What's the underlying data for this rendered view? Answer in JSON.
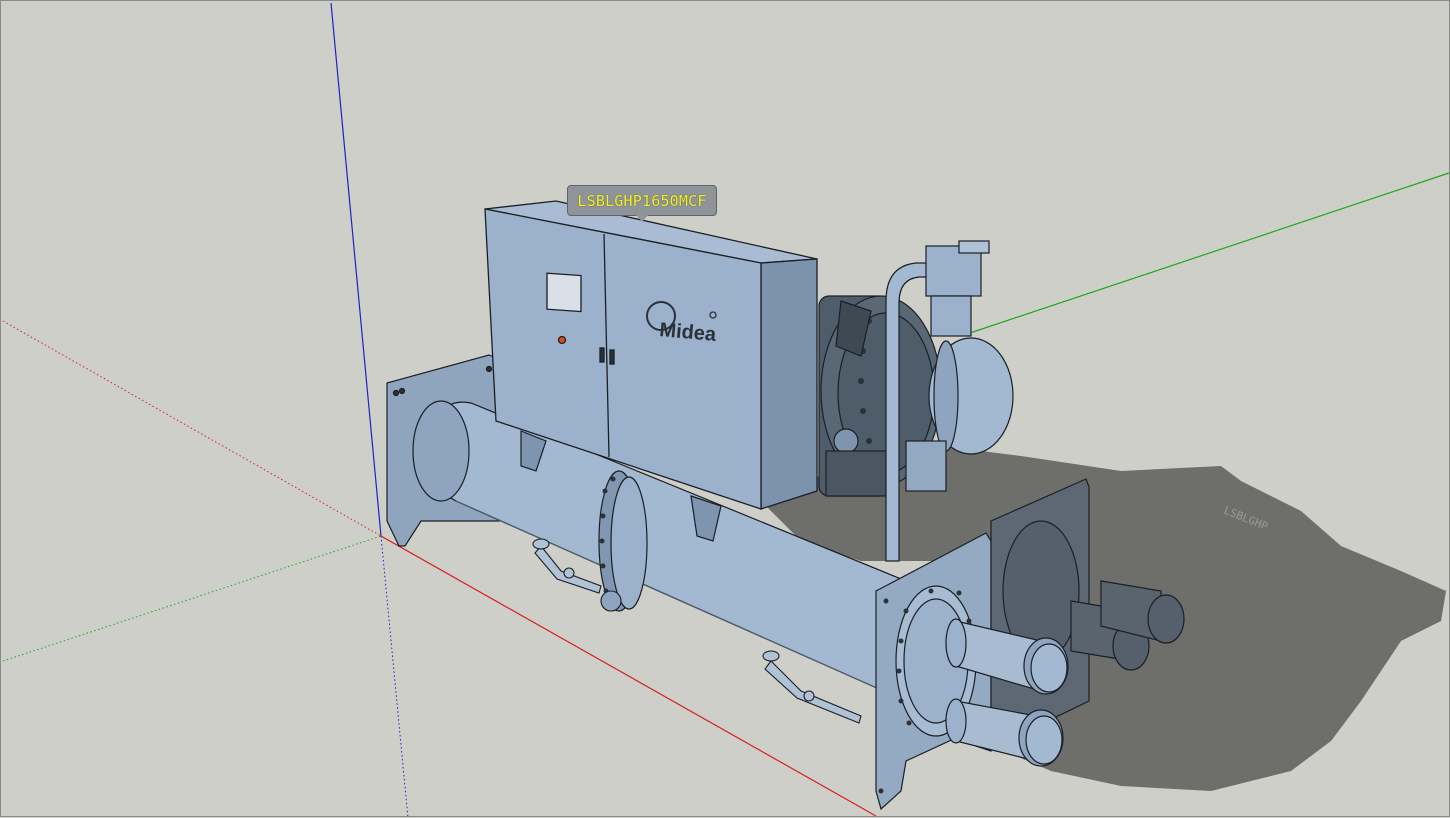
{
  "viewport": {
    "name": "sketchup-3d-model-viewport",
    "background": "#cfcfca"
  },
  "model": {
    "tag_label": "LSBLGHP1650MCF",
    "brand_text": "Midea",
    "shadow_label": "LSBLGHP"
  },
  "axes": {
    "red": "#d42020",
    "green": "#1ea51e",
    "blue": "#2020c8"
  },
  "colors": {
    "unit_body": "#9cb2cc",
    "unit_dark": "#4f5c69",
    "shadow": "#6e6e6b",
    "edge": "#1a1f24"
  }
}
